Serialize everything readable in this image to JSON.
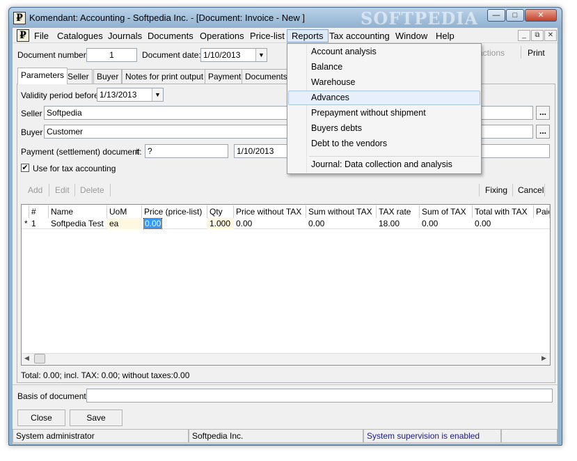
{
  "window": {
    "title": "Komendant: Accounting - Softpedia Inc. - [Document: Invoice - New ]",
    "app_icon": "₽",
    "watermark": "SOFTPEDIA",
    "controls": {
      "minimize": "—",
      "maximize": "□",
      "close": "✕"
    }
  },
  "menu": {
    "file": "File",
    "catalogues": "Catalogues",
    "journals": "Journals",
    "documents": "Documents",
    "operations": "Operations",
    "pricelist": "Price-list",
    "reports": "Reports",
    "tax": "Tax accounting",
    "window": "Window",
    "help": "Help",
    "mdi": {
      "minimize": "_",
      "restore": "⧉",
      "close": "✕"
    }
  },
  "reports_menu": {
    "items": [
      "Account analysis",
      "Balance",
      "Warehouse",
      "Advances",
      "Prepayment without shipment",
      "Buyers debts",
      "Debt to the vendors",
      "Journal: Data collection and analysis"
    ],
    "highlighted": "Advances"
  },
  "toolbar": {
    "doc_number_label": "Document number:",
    "doc_number": "1",
    "doc_date_label": "Document date:",
    "doc_date": "1/10/2013",
    "more_actions": "e actions",
    "print": "Print"
  },
  "tabs": [
    "Parameters",
    "Seller",
    "Buyer",
    "Notes for print output",
    "Payment",
    "Documents"
  ],
  "params": {
    "validity_label": "Validity period before",
    "validity_date": "1/13/2013",
    "seller_label": "Seller",
    "seller_value": "Softpedia",
    "buyer_label": "Buyer",
    "buyer_value": "Customer",
    "payment_label": "Payment (settlement) document:",
    "payment_hash": "#",
    "payment_number": "?",
    "payment_date": "1/10/2013",
    "use_tax_label": "Use for tax accounting",
    "use_tax_checked": true,
    "ellipsis": "..."
  },
  "row_actions": {
    "add": "Add",
    "edit": "Edit",
    "delete": "Delete",
    "fixing": "Fixing",
    "cancel": "Cancel"
  },
  "grid": {
    "columns": [
      "#",
      "Name",
      "UoM",
      "Price (price-list)",
      "Qty",
      "Price without TAX",
      "Sum without TAX",
      "TAX rate",
      "Sum of TAX",
      "Total with TAX",
      "Paid"
    ],
    "rows": [
      {
        "marker": "*",
        "num": "1",
        "name": "Softpedia Test",
        "uom": "ea",
        "price": "0.00",
        "qty": "1.000",
        "price_wo_tax": "0.00",
        "sum_wo_tax": "0.00",
        "tax_rate": "18.00",
        "sum_tax": "0.00",
        "total": "0.00"
      }
    ]
  },
  "totals": "Total: 0.00; incl. TAX: 0.00; without taxes:0.00",
  "basis_label": "Basis of document:",
  "buttons": {
    "close": "Close",
    "save": "Save"
  },
  "status": {
    "user": "System administrator",
    "company": "Softpedia Inc.",
    "supervision": "System supervision is enabled"
  },
  "colors": {
    "titlebar": "#8fb4d4",
    "highlight_cell": "#fff8e0",
    "selection": "#3399ff",
    "status_link": "#1a1a8a"
  }
}
